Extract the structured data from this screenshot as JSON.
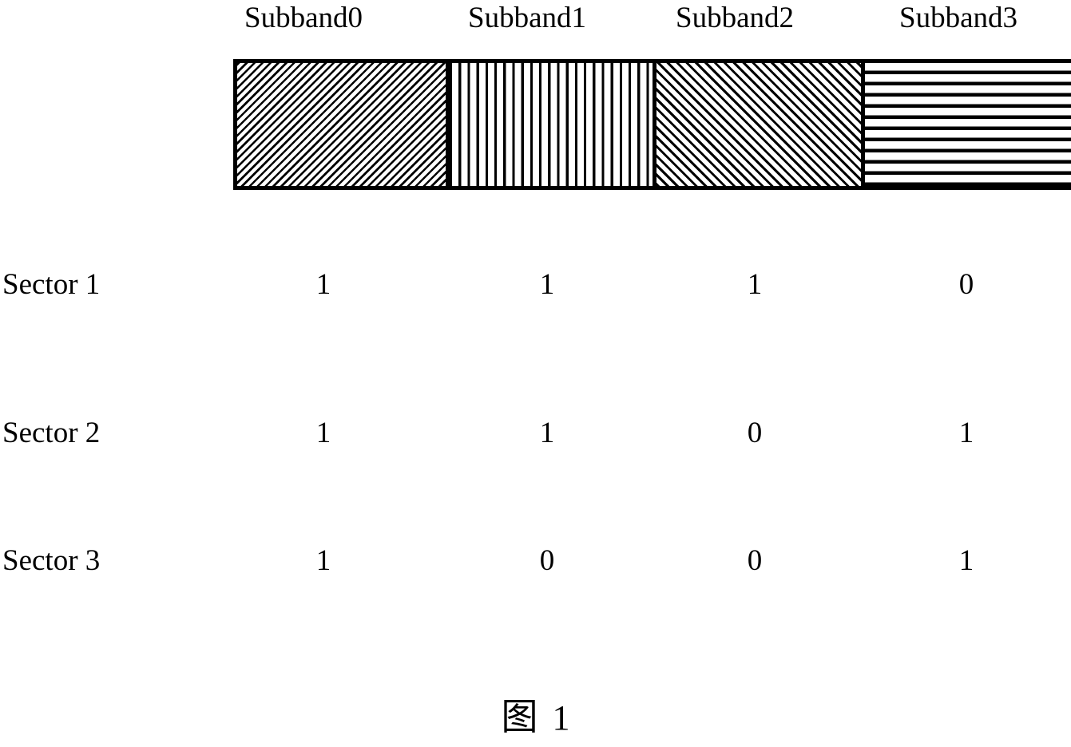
{
  "figure": {
    "caption_cjk": "图",
    "caption_number": "1",
    "caption_full": "图 1"
  },
  "columns": [
    {
      "label": "Subband0",
      "pattern": "diagonal-backslash-hatch"
    },
    {
      "label": "Subband1",
      "pattern": "vertical-lines"
    },
    {
      "label": "Subband2",
      "pattern": "diagonal-forwardslash-hatch"
    },
    {
      "label": "Subband3",
      "pattern": "horizontal-lines"
    }
  ],
  "rows": [
    {
      "label": "Sector 1",
      "values": [
        "1",
        "1",
        "1",
        "0"
      ]
    },
    {
      "label": "Sector 2",
      "values": [
        "1",
        "1",
        "0",
        "1"
      ]
    },
    {
      "label": "Sector 3",
      "values": [
        "1",
        "0",
        "0",
        "1"
      ]
    }
  ],
  "colors": {
    "ink": "#000000",
    "paper": "#ffffff"
  },
  "chart_data": {
    "type": "table",
    "title": "图 1",
    "columns": [
      "Subband0",
      "Subband1",
      "Subband2",
      "Subband3"
    ],
    "row_labels": [
      "Sector 1",
      "Sector 2",
      "Sector 3"
    ],
    "values": [
      [
        1,
        1,
        1,
        0
      ],
      [
        1,
        1,
        0,
        1
      ],
      [
        1,
        0,
        0,
        1
      ]
    ],
    "band_patterns": [
      "diagonal-backslash-hatch",
      "vertical-lines",
      "diagonal-forwardslash-hatch",
      "horizontal-lines"
    ],
    "xlabel": "",
    "ylabel": "",
    "grid": false,
    "legend": "none"
  }
}
